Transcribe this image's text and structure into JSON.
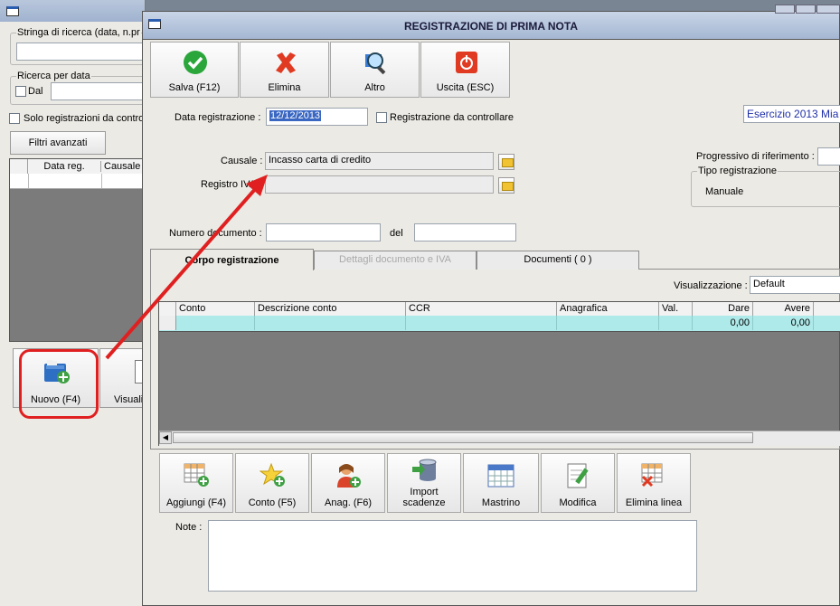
{
  "bg_window": {
    "search_label": "Stringa di ricerca (data, n.pr",
    "date_search_label": "Ricerca per data",
    "dal_label": "Dal",
    "solo_label": "Solo registrazioni da contro",
    "filtri_label": "Filtri avanzati",
    "grid_headers": [
      "Data reg.",
      "Causale"
    ],
    "nuovo_label": "Nuovo (F4)",
    "visual_label": "Visuali"
  },
  "main_window": {
    "title": "REGISTRAZIONE DI PRIMA NOTA",
    "toolbar": {
      "save": "Salva (F12)",
      "delete": "Elimina",
      "other": "Altro",
      "exit": "Uscita (ESC)"
    },
    "data_reg_label": "Data registrazione :",
    "data_reg_value": "12/12/2013",
    "da_controllare_label": "Registrazione da controllare",
    "esercizio": "Esercizio 2013 Mia",
    "progressivo_label": "Progressivo di riferimento :",
    "tipo_reg_label": "Tipo registrazione",
    "tipo_reg_value": "Manuale",
    "causale_label": "Causale :",
    "causale_value": "Incasso carta di credito",
    "registro_label": "Registro IVA",
    "numero_doc_label": "Numero documento :",
    "del_label": "del",
    "tabs": [
      "Corpo registrazione",
      "Dettagli documento e IVA",
      "Documenti ( 0 )"
    ],
    "visualizzazione_label": "Visualizzazione :",
    "visualizzazione_value": "Default",
    "columns": [
      "Conto",
      "Descrizione conto",
      "CCR",
      "Anagrafica",
      "Val.",
      "Dare",
      "Avere"
    ],
    "row": {
      "dare": "0,00",
      "avere": "0,00"
    },
    "bottom_buttons": {
      "add": "Aggiungi (F4)",
      "conto": "Conto (F5)",
      "anag": "Anag. (F6)",
      "import_1": "Import",
      "import_2": "scadenze",
      "mastrino": "Mastrino",
      "modifica": "Modifica",
      "elimina_linea": "Elimina linea"
    },
    "note_label": "Note :"
  },
  "colors": {
    "highlight_red": "#e02020",
    "selected_row": "#aeeaea",
    "grid_bg": "#7b7b7b",
    "esercizio_text": "#1f2fa8"
  }
}
